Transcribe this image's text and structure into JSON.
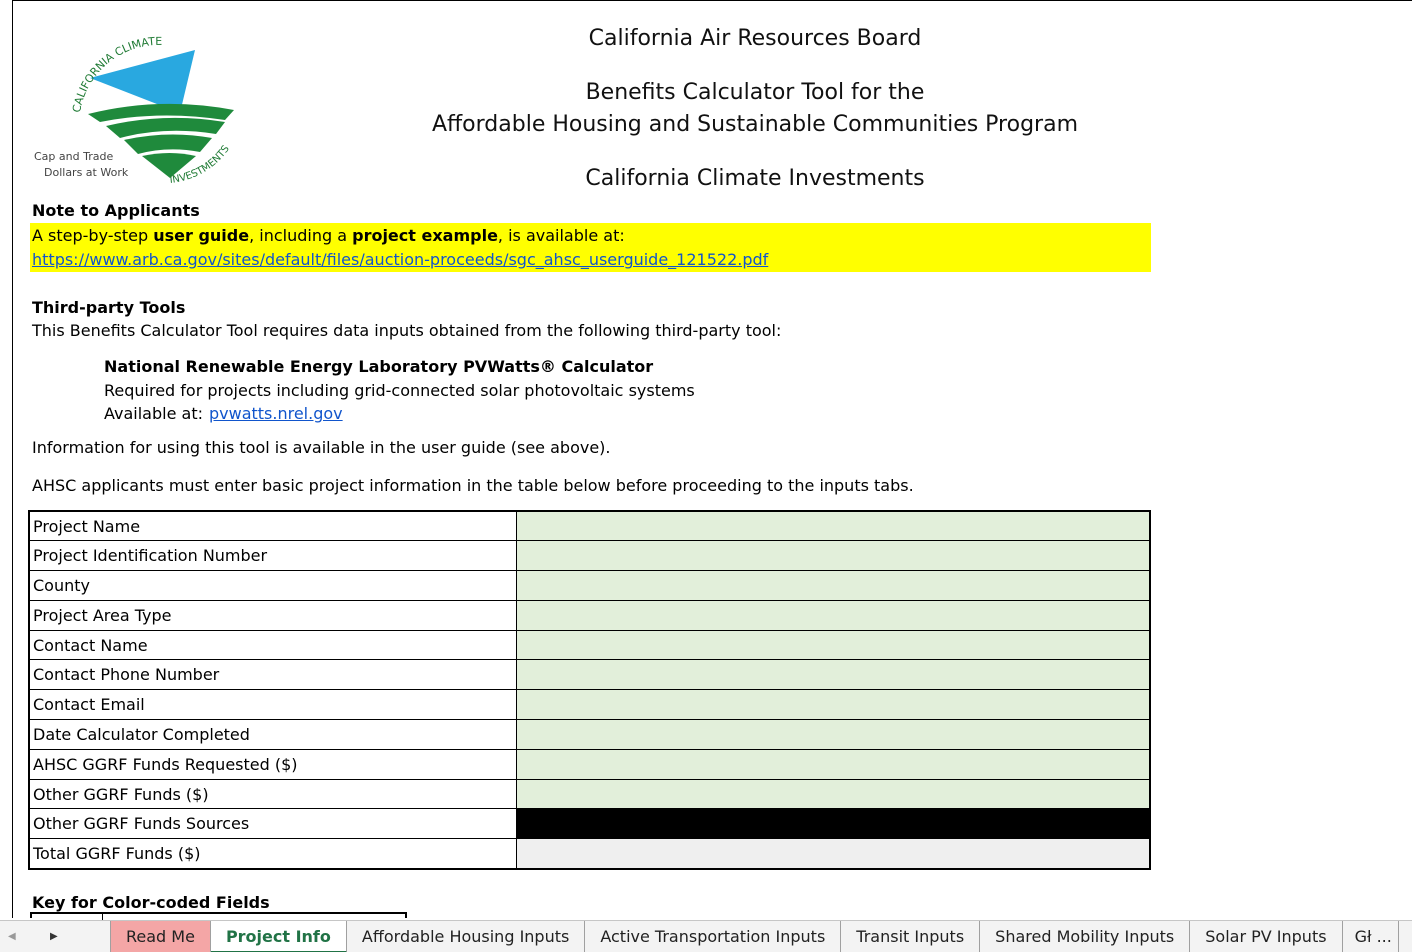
{
  "logo": {
    "arc_top": "CALIFORNIA CLIMATE",
    "arc_bottom": "INVESTMENTS",
    "tagline_1": "Cap and Trade",
    "tagline_2": "Dollars at Work",
    "colors": {
      "blue": "#29a8e0",
      "green": "#1f8a3c"
    }
  },
  "header": {
    "org": "California Air Resources Board",
    "title_1": "Benefits Calculator Tool for the",
    "title_2": "Affordable Housing and Sustainable Communities Program",
    "subtitle": "California Climate Investments"
  },
  "note": {
    "title": "Note to Applicants",
    "line_pre": "A step-by-step ",
    "line_b1": "user guide",
    "line_mid": ", including a ",
    "line_b2": "project example",
    "line_post": ", is available at:",
    "link": "https://www.arb.ca.gov/sites/default/files/auction-proceeds/sgc_ahsc_userguide_121522.pdf"
  },
  "third_party": {
    "title": "Third-party Tools",
    "desc": "This Benefits Calculator Tool requires data inputs obtained from the following third-party tool:",
    "tool_name": "National Renewable Energy Laboratory PVWatts® Calculator",
    "tool_desc": "Required for projects including grid-connected solar photovoltaic systems",
    "avail_label": "Available at:",
    "avail_link": "pvwatts.nrel.gov"
  },
  "info_line": "Information for using this tool is available in the user guide (see above).",
  "ahsc_line": "AHSC applicants must enter basic project information in the table below before proceeding to the inputs tabs.",
  "project_table": {
    "rows": [
      {
        "label": "Project Name",
        "value": ""
      },
      {
        "label": "Project Identification Number",
        "value": ""
      },
      {
        "label": "County",
        "value": ""
      },
      {
        "label": "Project Area Type",
        "value": ""
      },
      {
        "label": "Contact Name",
        "value": ""
      },
      {
        "label": "Contact Phone Number",
        "value": ""
      },
      {
        "label": "Contact Email",
        "value": ""
      },
      {
        "label": "Date Calculator Completed",
        "value": ""
      },
      {
        "label": "AHSC GGRF Funds Requested ($)",
        "value": ""
      },
      {
        "label": "Other GGRF Funds ($)",
        "value": ""
      },
      {
        "label": "Other GGRF Funds Sources",
        "value": ""
      },
      {
        "label": "Total GGRF Funds ($)",
        "value": ""
      }
    ],
    "colors": {
      "input": "#e2efda",
      "blocked": "#000000",
      "calculated": "#efefef"
    }
  },
  "key_title": "Key for Color-coded Fields",
  "tabs": {
    "prev_icon": "triangle-left-icon",
    "next_icon": "triangle-right-icon",
    "items": [
      {
        "label": "Read Me"
      },
      {
        "label": "Project Info"
      },
      {
        "label": "Affordable Housing Inputs"
      },
      {
        "label": "Active Transportation Inputs"
      },
      {
        "label": "Transit Inputs"
      },
      {
        "label": "Shared Mobility Inputs"
      },
      {
        "label": "Solar PV Inputs"
      },
      {
        "label": "Gł ..."
      }
    ],
    "active_color": "#217346",
    "readme_color": "#f4a6a6"
  }
}
